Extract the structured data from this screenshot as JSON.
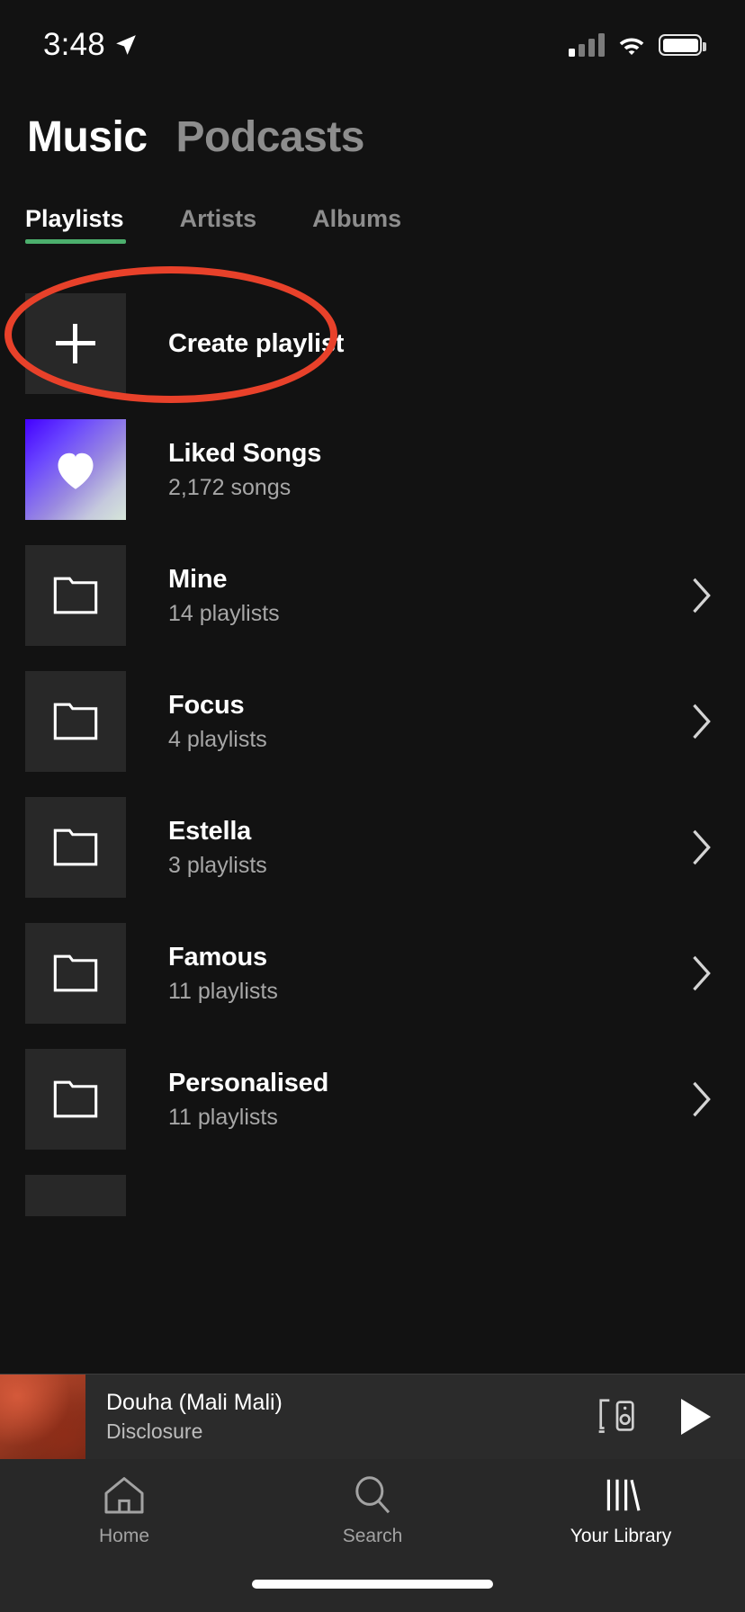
{
  "status_bar": {
    "time": "3:48",
    "location_icon": "location-arrow-icon",
    "cellular_icon": "cellular-signal-icon",
    "wifi_icon": "wifi-icon",
    "battery_icon": "battery-icon"
  },
  "header": {
    "primary_tab": "Music",
    "secondary_tab": "Podcasts"
  },
  "filter_tabs": [
    {
      "label": "Playlists",
      "active": true
    },
    {
      "label": "Artists",
      "active": false
    },
    {
      "label": "Albums",
      "active": false
    }
  ],
  "annotation": {
    "shape": "ellipse",
    "color": "#e8412a",
    "targets": "Create playlist"
  },
  "accent_color": "#4caf6d",
  "list": [
    {
      "title": "Create playlist",
      "subtitle": "",
      "icon": "plus-icon",
      "chevron": false
    },
    {
      "title": "Liked Songs",
      "subtitle": "2,172 songs",
      "icon": "heart-icon",
      "chevron": false
    },
    {
      "title": "Mine",
      "subtitle": "14 playlists",
      "icon": "folder-icon",
      "chevron": true
    },
    {
      "title": "Focus",
      "subtitle": "4 playlists",
      "icon": "folder-icon",
      "chevron": true
    },
    {
      "title": "Estella",
      "subtitle": "3 playlists",
      "icon": "folder-icon",
      "chevron": true
    },
    {
      "title": "Famous",
      "subtitle": "11 playlists",
      "icon": "folder-icon",
      "chevron": true
    },
    {
      "title": "Personalised",
      "subtitle": "11 playlists",
      "icon": "folder-icon",
      "chevron": true
    },
    {
      "title": "",
      "subtitle": "",
      "icon": "folder-icon",
      "chevron": false
    }
  ],
  "now_playing": {
    "track": "Douha (Mali Mali)",
    "artist": "Disclosure",
    "devices_icon": "connect-to-device-icon",
    "play_icon": "play-icon",
    "artwork": "album-artwork"
  },
  "bottom_nav": [
    {
      "label": "Home",
      "icon": "home-icon",
      "active": false
    },
    {
      "label": "Search",
      "icon": "search-icon",
      "active": false
    },
    {
      "label": "Your Library",
      "icon": "library-icon",
      "active": true
    }
  ]
}
